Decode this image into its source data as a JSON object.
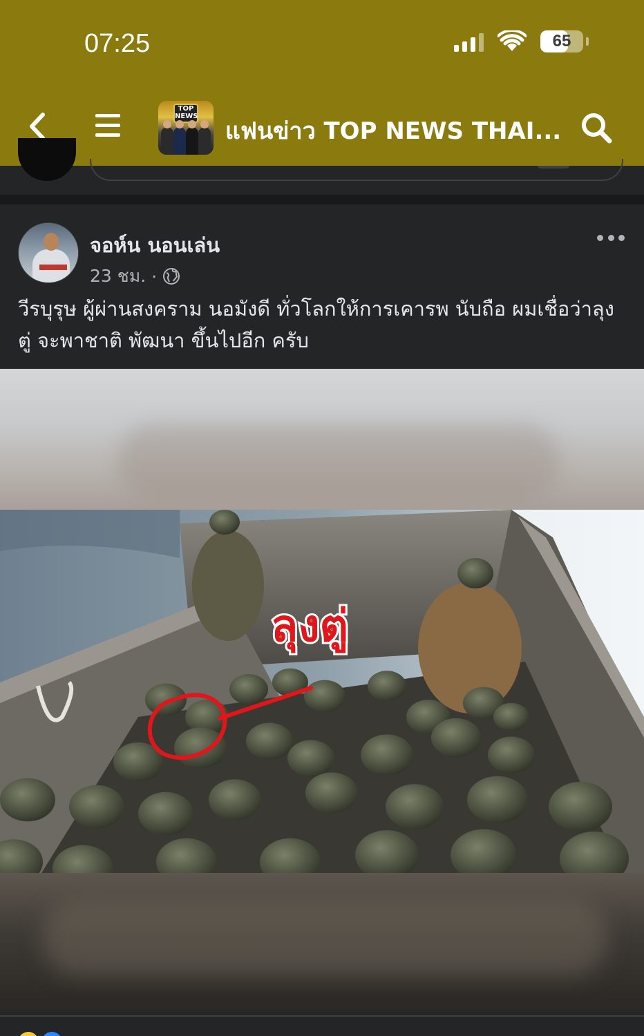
{
  "status_bar": {
    "time": "07:25",
    "battery_percent": "65",
    "battery_level": 0.65,
    "icons": [
      "cellular-signal-icon",
      "wifi-icon",
      "battery-icon"
    ]
  },
  "header": {
    "page_title": "แฟนข่าว TOP NEWS THAI...",
    "avatar_logo_lines": [
      "TOP",
      "NEWS"
    ],
    "icons": [
      "back-chevron-icon",
      "menu-icon",
      "search-icon"
    ]
  },
  "post": {
    "author_name": "จอห์น นอนเล่น",
    "timestamp": "23 ชม.",
    "separator": "·",
    "privacy_icon": "globe-icon",
    "text": "วีรบุรุษ ผู้ผ่านสงคราม นอมังดี ทั่วโลกให้การเคารพ นับถือ ผมเชื่อว่าลุงตู่ จะพาชาติ พัฒนา ขึ้นไปอีก ครับ",
    "image_caption": "ลุงตู่",
    "more_icon": "more-options-icon"
  },
  "colors": {
    "header_bg": "#8b7a0e",
    "feed_bg": "#18191a",
    "card_bg": "#242526",
    "annotation_red": "#e0161b"
  }
}
